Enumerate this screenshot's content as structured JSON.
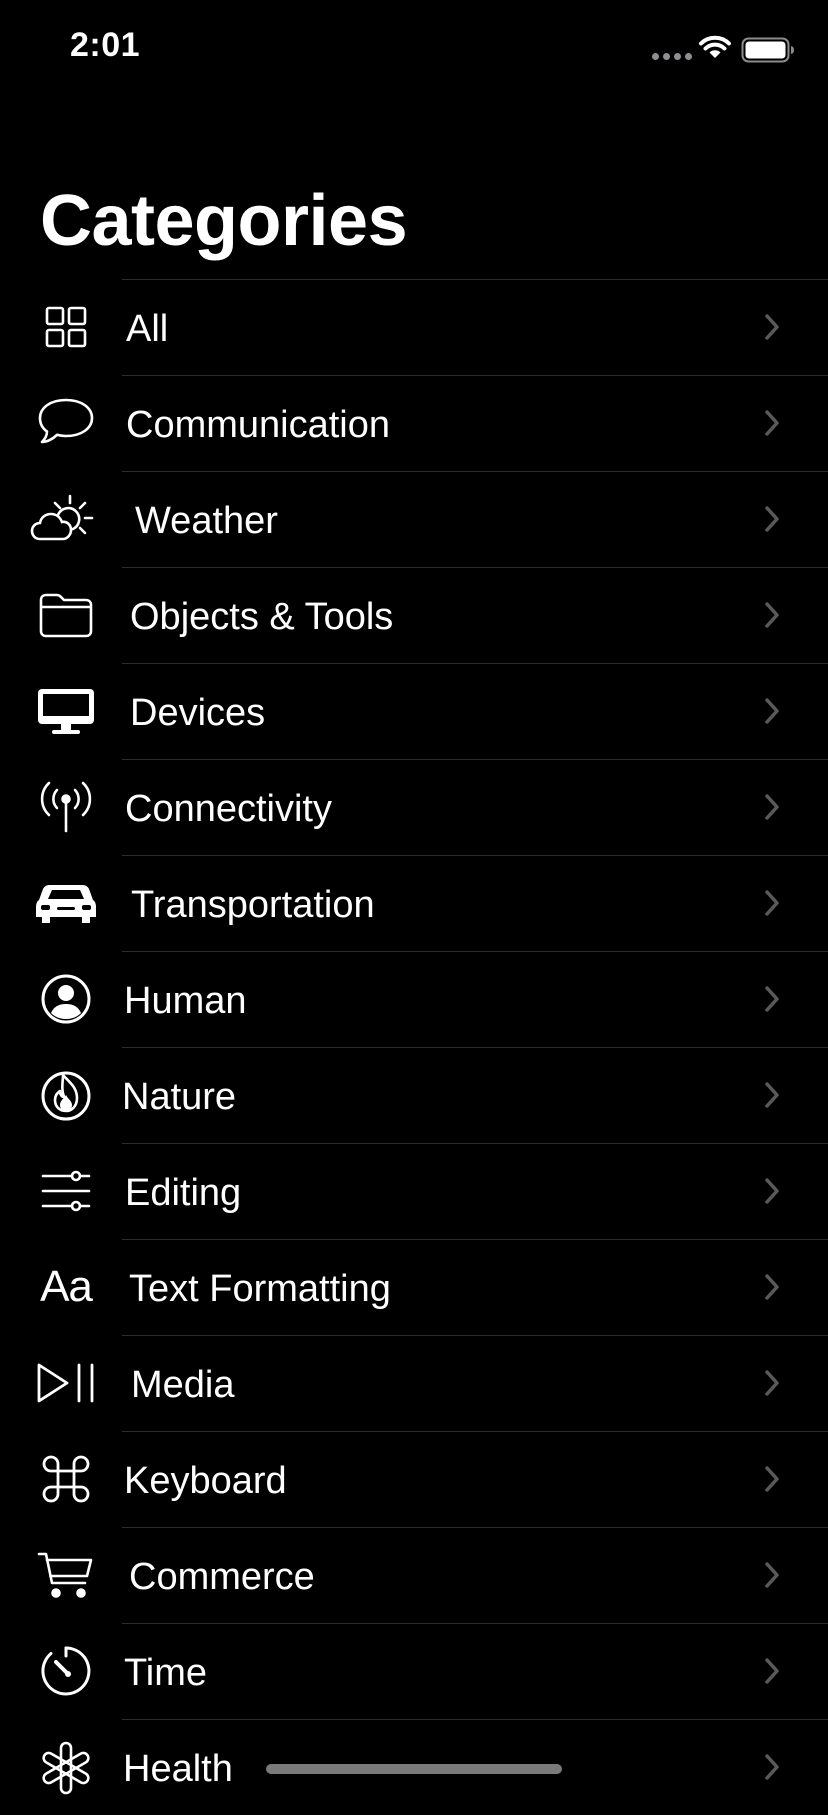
{
  "status_bar": {
    "time": "2:01"
  },
  "page": {
    "title": "Categories"
  },
  "categories": [
    {
      "label": "All",
      "icon": "square-grid-icon"
    },
    {
      "label": "Communication",
      "icon": "speech-bubble-icon"
    },
    {
      "label": "Weather",
      "icon": "cloud-sun-icon"
    },
    {
      "label": "Objects & Tools",
      "icon": "folder-icon"
    },
    {
      "label": "Devices",
      "icon": "desktop-computer-icon"
    },
    {
      "label": "Connectivity",
      "icon": "antenna-radiowaves-icon"
    },
    {
      "label": "Transportation",
      "icon": "car-icon"
    },
    {
      "label": "Human",
      "icon": "person-circle-icon"
    },
    {
      "label": "Nature",
      "icon": "flame-icon"
    },
    {
      "label": "Editing",
      "icon": "slider-horizontal-icon"
    },
    {
      "label": "Text Formatting",
      "icon": "textformat-icon",
      "glyph": "Aa"
    },
    {
      "label": "Media",
      "icon": "play-pause-icon"
    },
    {
      "label": "Keyboard",
      "icon": "command-icon"
    },
    {
      "label": "Commerce",
      "icon": "cart-icon"
    },
    {
      "label": "Time",
      "icon": "timer-icon"
    },
    {
      "label": "Health",
      "icon": "asterisk-medical-icon"
    }
  ]
}
